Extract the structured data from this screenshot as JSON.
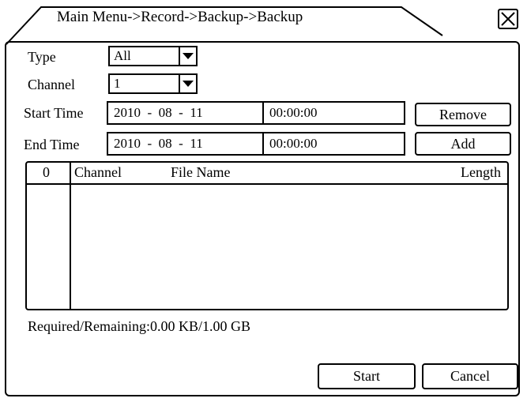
{
  "window": {
    "title": "Main Menu->Record->Backup->Backup",
    "close_icon": "close-x-icon"
  },
  "form": {
    "type": {
      "label": "Type",
      "value": "All"
    },
    "channel": {
      "label": "Channel",
      "value": "1"
    },
    "start_time": {
      "label": "Start Time",
      "date": "2010  -  08  -  11",
      "time": "00:00:00"
    },
    "end_time": {
      "label": "End Time",
      "date": "2010  -  08  -  11",
      "time": "00:00:00"
    }
  },
  "buttons": {
    "remove": "Remove",
    "add": "Add",
    "start": "Start",
    "cancel": "Cancel"
  },
  "table": {
    "columns": {
      "index": "0",
      "channel": "Channel",
      "file_name": "File Name",
      "length": "Length"
    },
    "rows": []
  },
  "status": {
    "required_remaining": "Required/Remaining:0.00 KB/1.00 GB"
  }
}
